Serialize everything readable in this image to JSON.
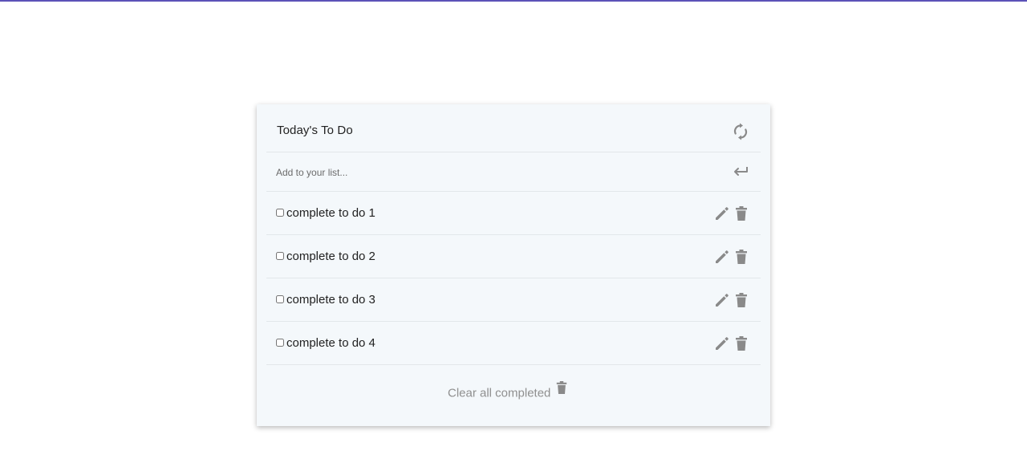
{
  "todo": {
    "title": "Today's To Do",
    "input": {
      "placeholder": "Add to your list...",
      "value": ""
    },
    "items": [
      {
        "label": "complete to do 1",
        "checked": false
      },
      {
        "label": "complete to do 2",
        "checked": false
      },
      {
        "label": "complete to do 3",
        "checked": false
      },
      {
        "label": "complete to do 4",
        "checked": false
      }
    ],
    "clear_label": "Clear all completed"
  },
  "icons": {
    "refresh": "refresh-icon",
    "enter": "enter-arrow-icon",
    "edit": "pencil-icon",
    "delete": "trash-icon"
  },
  "colors": {
    "accent_border": "#5b52b8",
    "card_background": "#f4f8fb",
    "icon_gray": "#8a8a8a"
  }
}
